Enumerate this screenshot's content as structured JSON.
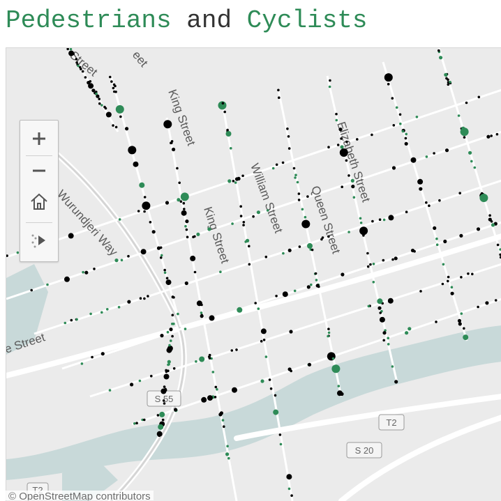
{
  "title": {
    "word1": "Pedestrians",
    "word2": "and",
    "word3": "Cyclists"
  },
  "colors": {
    "pedestrian": "#000000",
    "cyclist": "#2e8b57",
    "water": "#c8d9d9",
    "land": "#ebebeb",
    "road": "#ffffff"
  },
  "map": {
    "street_labels": {
      "street_top": "Street",
      "street_top2": "eet",
      "king1": "King Street",
      "king2": "King Street",
      "william": "William Street",
      "queen": "Queen Street",
      "elizabeth": "Elizabeth Street",
      "wurundjeri": "Wurundjeri Way",
      "west_street": "e Street"
    },
    "route_shields": {
      "s55": "S 55",
      "t2a": "T2",
      "s20": "S 20",
      "t2b": "T2"
    },
    "attribution": "© OpenStreetMap contributors"
  },
  "controls": {
    "zoom_in": "+",
    "zoom_out": "−",
    "home_icon": "home-icon",
    "pan_icon": "play-arrow-icon"
  }
}
